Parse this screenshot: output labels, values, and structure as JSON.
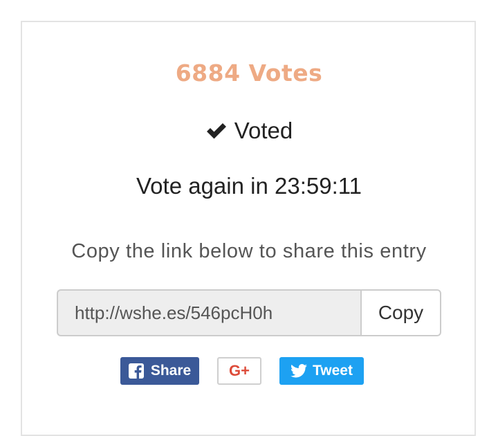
{
  "votes": {
    "count_label": "6884 Votes"
  },
  "status": {
    "voted_label": "Voted"
  },
  "countdown": {
    "label": "Vote again in 23:59:11"
  },
  "share": {
    "hint": "Copy the link below to share this entry",
    "link_value": "http://wshe.es/546pcH0h",
    "copy_label": "Copy"
  },
  "social": {
    "facebook_label": "Share",
    "google_label": "G+",
    "twitter_label": "Tweet"
  },
  "colors": {
    "votes_accent": "#eeaa84",
    "facebook": "#3b5998",
    "twitter": "#1da1f2",
    "google": "#dd4b39"
  },
  "icons": {
    "voted": "checkmark-icon",
    "facebook": "facebook-icon",
    "twitter": "twitter-bird-icon"
  }
}
